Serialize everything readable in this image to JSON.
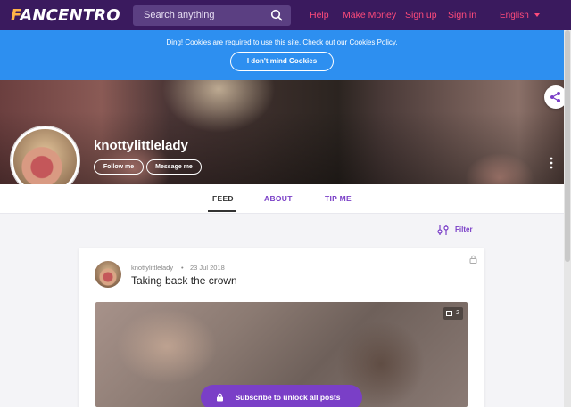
{
  "header": {
    "logo_a": "F",
    "logo_b": "ANCENTRO",
    "search_placeholder": "Search anything",
    "nav": [
      "Help",
      "Make Money",
      "Sign up",
      "Sign in"
    ],
    "language": "English"
  },
  "cookie": {
    "message": "Ding! Cookies are required to use this site. Check out our Cookies Policy.",
    "button": "I don't mind Cookies"
  },
  "profile": {
    "username": "knottylittlelady",
    "follow_label": "Follow me",
    "message_label": "Message me"
  },
  "tabs": [
    "FEED",
    "ABOUT",
    "TIP ME"
  ],
  "filter_label": "Filter",
  "post": {
    "author": "knottylittlelady",
    "separator": "•",
    "date": "23 Jul 2018",
    "title": "Taking back the crown",
    "media_count": "2",
    "subscribe_label": "Subscribe to unlock all posts"
  },
  "colors": {
    "header_bg": "#3a1a5e",
    "accent_pink": "#ff4b7b",
    "accent_purple": "#7a3fc7",
    "cookie_blue": "#2d8ff0"
  }
}
